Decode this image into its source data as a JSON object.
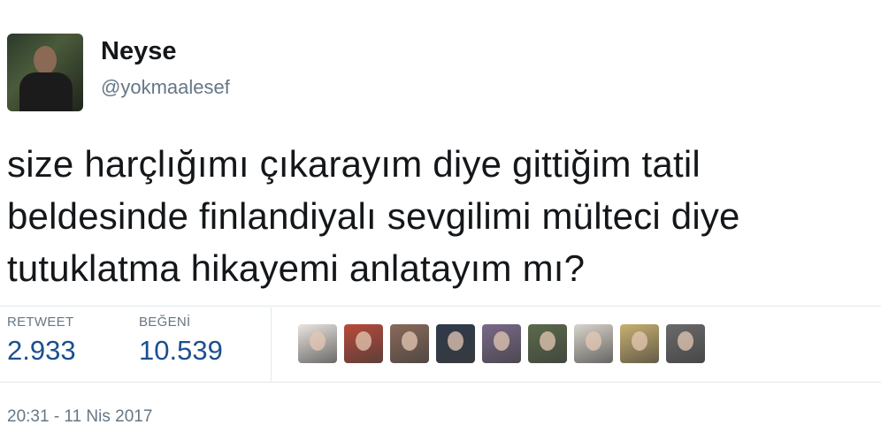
{
  "author": {
    "name": "Neyse",
    "handle": "@yokmaalesef"
  },
  "tweet": {
    "lines": [
      "size harçlığımı çıkarayım diye gittiğim tatil",
      "beldesinde finlandiyalı sevgilimi mülteci diye",
      "tutuklatma hikayemi anlatayım mı?"
    ]
  },
  "stats": {
    "retweet_label": "RETWEET",
    "retweet_value": "2.933",
    "like_label": "BEĞENİ",
    "like_value": "10.539"
  },
  "likers": [
    {
      "color": "#e9e4df"
    },
    {
      "color": "#b84a3a"
    },
    {
      "color": "#8a6a5a"
    },
    {
      "color": "#2f3a4a"
    },
    {
      "color": "#7a6a8a"
    },
    {
      "color": "#5a6a4a"
    },
    {
      "color": "#d8d4cc"
    },
    {
      "color": "#c9b070"
    },
    {
      "color": "#6a6a6a"
    }
  ],
  "timestamp": "20:31 - 11 Nis 2017",
  "colors": {
    "link_blue": "#1c4f8f",
    "muted": "#657786",
    "text": "#14171a",
    "divider": "#e1e8ed"
  }
}
